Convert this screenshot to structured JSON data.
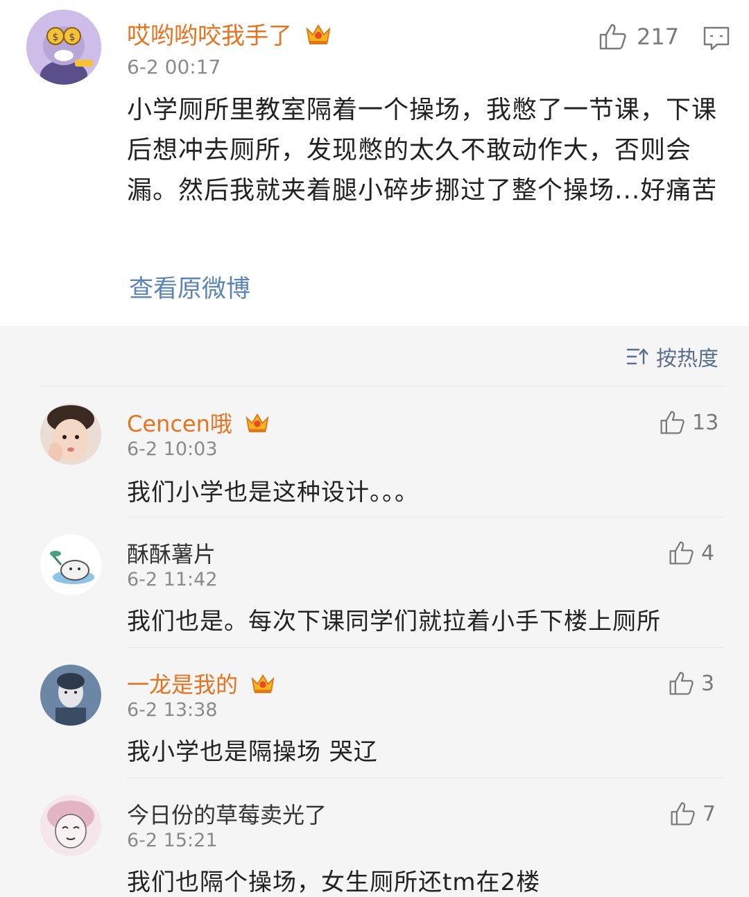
{
  "main_post": {
    "author": "哎哟哟咬我手了",
    "timestamp": "6-2 00:17",
    "like_count": "217",
    "text": "小学厕所里教室隔着一个操场，我憋了一节课，下课后想冲去厕所，发现憋的太久不敢动作大，否则会漏。然后我就夹着腿小碎步挪过了整个操场...好痛苦",
    "view_original": "查看原微博"
  },
  "sort": {
    "label": "按热度"
  },
  "comments": [
    {
      "author": "Cencen哦",
      "vip": true,
      "timestamp": "6-2 10:03",
      "text": "我们小学也是这种设计。。。",
      "like_count": "13"
    },
    {
      "author": "酥酥薯片",
      "vip": false,
      "timestamp": "6-2 11:42",
      "text": "我们也是。每次下课同学们就拉着小手下楼上厕所",
      "like_count": "4"
    },
    {
      "author": "一龙是我的",
      "vip": true,
      "timestamp": "6-2 13:38",
      "text": "我小学也是隔操场 哭辽",
      "like_count": "3"
    },
    {
      "author": "今日份的草莓卖光了",
      "vip": false,
      "timestamp": "6-2 15:21",
      "text": "我们也隔个操场，女生厕所还tm在2楼",
      "like_count": "7"
    }
  ],
  "colors": {
    "vip_name": "#e8731f",
    "link": "#5a84b6",
    "muted": "#8a8a8a",
    "background": "#f5f5f5"
  },
  "icons": [
    "thumbs-up-icon",
    "comment-icon",
    "vip-crown-icon",
    "sort-icon",
    "avatar"
  ]
}
